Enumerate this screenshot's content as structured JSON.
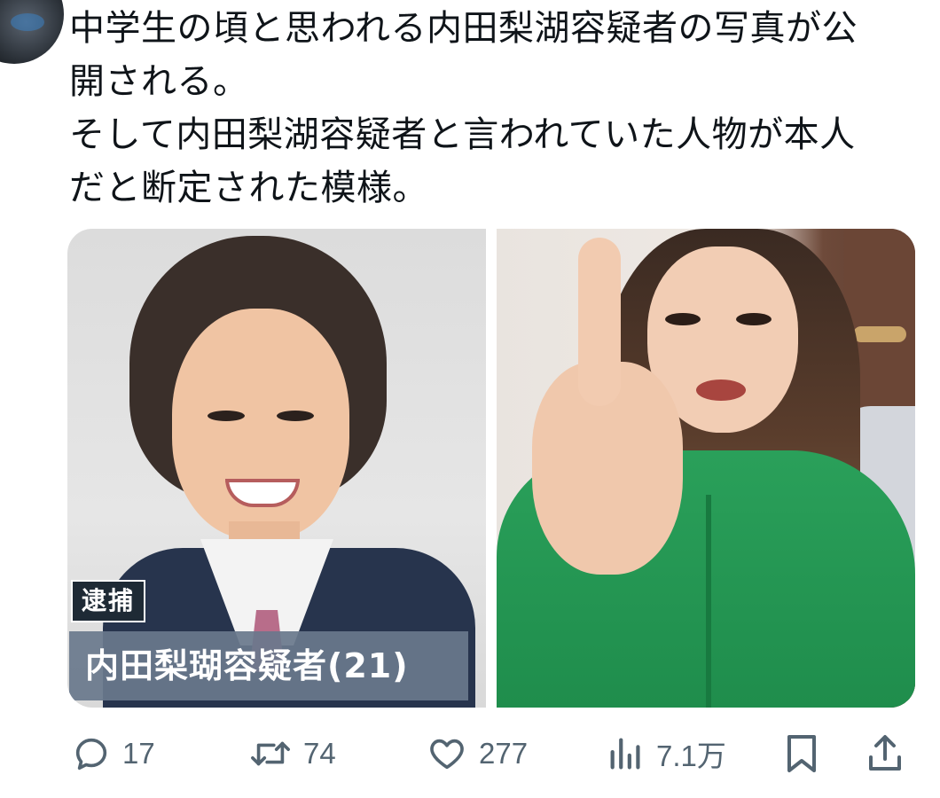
{
  "tweet": {
    "text_lines": [
      "中学生の頃と思われる内田梨湖容疑者の写真が公\n開される。",
      "そして内田梨湖容疑者と言われていた人物が本人\nだと断定された模様。"
    ]
  },
  "media": {
    "left_caption_tag": "逮捕",
    "left_caption_name": "内田梨瑚容疑者(21)"
  },
  "actions": {
    "reply_count": "17",
    "retweet_count": "74",
    "like_count": "277",
    "views_count": "7.1万"
  },
  "colors": {
    "text": "#0f1419",
    "icon": "#536471"
  }
}
